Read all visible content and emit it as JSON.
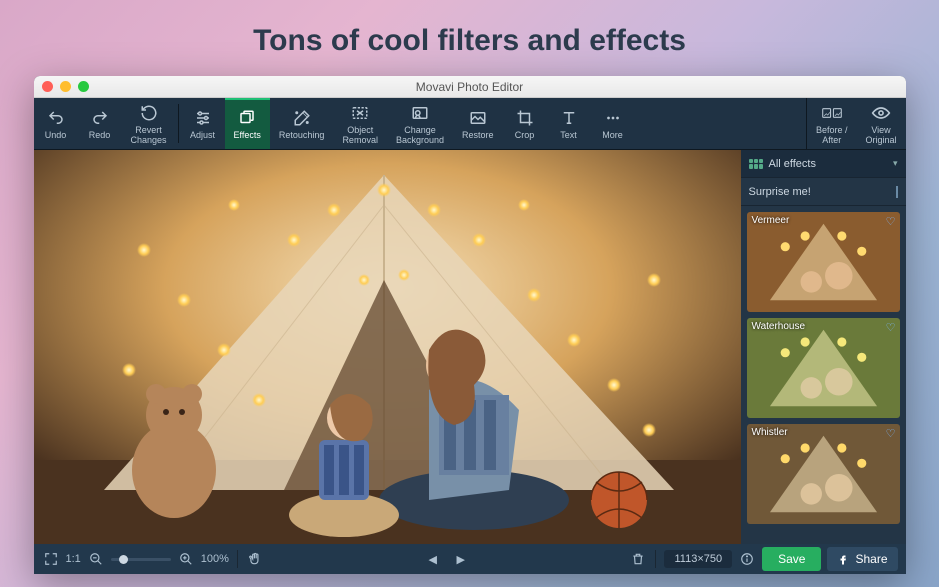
{
  "headline": "Tons of cool filters and effects",
  "window_title": "Movavi Photo Editor",
  "toolbar": {
    "undo": "Undo",
    "redo": "Redo",
    "revert": "Revert\nChanges",
    "adjust": "Adjust",
    "effects": "Effects",
    "retouching": "Retouching",
    "object_removal": "Object\nRemoval",
    "change_bg": "Change\nBackground",
    "restore": "Restore",
    "crop": "Crop",
    "text": "Text",
    "more": "More",
    "before_after": "Before /\nAfter",
    "view_original": "View\nOriginal"
  },
  "side": {
    "category": "All effects",
    "surprise": "Surprise me!",
    "thumbs": [
      {
        "name": "Vermeer"
      },
      {
        "name": "Waterhouse"
      },
      {
        "name": "Whistler"
      }
    ]
  },
  "status": {
    "zoom_ratio": "1:1",
    "zoom_pct": "100%",
    "dimensions": "1113×750",
    "save": "Save",
    "share": "Share"
  }
}
